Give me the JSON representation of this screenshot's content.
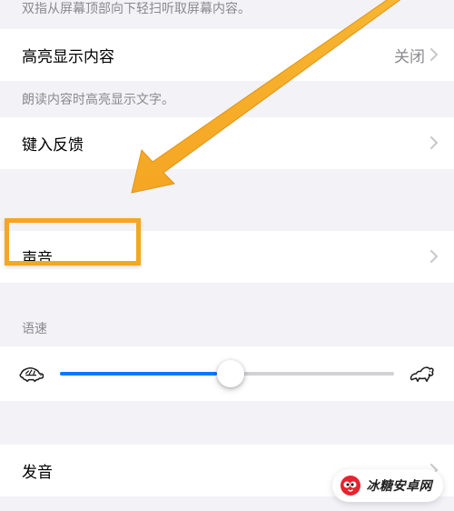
{
  "top_hint": "双指从屏幕顶部向下轻扫听取屏幕内容。",
  "highlight": {
    "label": "高亮显示内容",
    "value": "关闭"
  },
  "highlight_footer": "朗读内容时高亮显示文字。",
  "typing_feedback": {
    "label": "键入反馈"
  },
  "voice": {
    "label": "声音"
  },
  "speed_header": "语速",
  "pronunciation": {
    "label": "发音"
  },
  "watermark": "冰糖安卓网"
}
